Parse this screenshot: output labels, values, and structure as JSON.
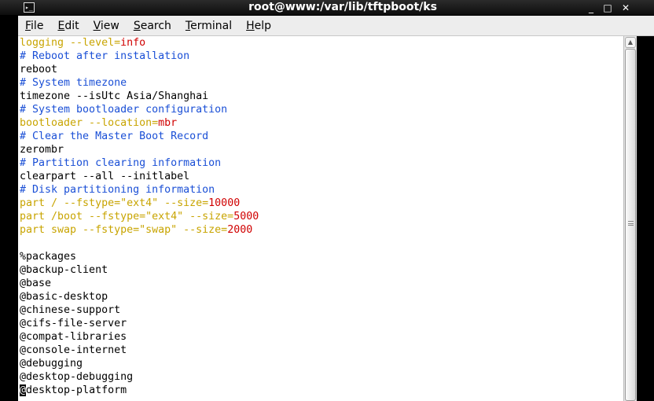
{
  "window": {
    "title": "root@www:/var/lib/tftpboot/ks",
    "minimize_glyph": "_",
    "maximize_glyph": "□",
    "close_glyph": "✕",
    "icon_glyph": "▸_"
  },
  "menu": [
    "File",
    "Edit",
    "View",
    "Search",
    "Terminal",
    "Help"
  ],
  "lines": [
    {
      "segs": [
        {
          "t": "logging --level=",
          "c": "key"
        },
        {
          "t": "info",
          "c": "val"
        }
      ]
    },
    {
      "segs": [
        {
          "t": "# Reboot after installation",
          "c": "comment"
        }
      ]
    },
    {
      "segs": [
        {
          "t": "reboot",
          "c": "plain"
        }
      ]
    },
    {
      "segs": [
        {
          "t": "# System timezone",
          "c": "comment"
        }
      ]
    },
    {
      "segs": [
        {
          "t": "timezone --isUtc Asia/Shanghai",
          "c": "plain"
        }
      ]
    },
    {
      "segs": [
        {
          "t": "# System bootloader configuration",
          "c": "comment"
        }
      ]
    },
    {
      "segs": [
        {
          "t": "bootloader --location=",
          "c": "key"
        },
        {
          "t": "mbr",
          "c": "val"
        }
      ]
    },
    {
      "segs": [
        {
          "t": "# Clear the Master Boot Record",
          "c": "comment"
        }
      ]
    },
    {
      "segs": [
        {
          "t": "zerombr",
          "c": "plain"
        }
      ]
    },
    {
      "segs": [
        {
          "t": "# Partition clearing information",
          "c": "comment"
        }
      ]
    },
    {
      "segs": [
        {
          "t": "clearpart --all --initlabel",
          "c": "plain"
        }
      ]
    },
    {
      "segs": [
        {
          "t": "# Disk partitioning information",
          "c": "comment"
        }
      ]
    },
    {
      "segs": [
        {
          "t": "part / --fstype=\"ext4\" --size=",
          "c": "key"
        },
        {
          "t": "10000",
          "c": "val"
        }
      ]
    },
    {
      "segs": [
        {
          "t": "part /boot --fstype=\"ext4\" --size=",
          "c": "key"
        },
        {
          "t": "5000",
          "c": "val"
        }
      ]
    },
    {
      "segs": [
        {
          "t": "part swap --fstype=\"swap\" --size=",
          "c": "key"
        },
        {
          "t": "2000",
          "c": "val"
        }
      ]
    },
    {
      "segs": [
        {
          "t": "",
          "c": "plain"
        }
      ]
    },
    {
      "segs": [
        {
          "t": "%packages",
          "c": "plain"
        }
      ]
    },
    {
      "segs": [
        {
          "t": "@backup-client",
          "c": "plain"
        }
      ]
    },
    {
      "segs": [
        {
          "t": "@base",
          "c": "plain"
        }
      ]
    },
    {
      "segs": [
        {
          "t": "@basic-desktop",
          "c": "plain"
        }
      ]
    },
    {
      "segs": [
        {
          "t": "@chinese-support",
          "c": "plain"
        }
      ]
    },
    {
      "segs": [
        {
          "t": "@cifs-file-server",
          "c": "plain"
        }
      ]
    },
    {
      "segs": [
        {
          "t": "@compat-libraries",
          "c": "plain"
        }
      ]
    },
    {
      "segs": [
        {
          "t": "@console-internet",
          "c": "plain"
        }
      ]
    },
    {
      "segs": [
        {
          "t": "@debugging",
          "c": "plain"
        }
      ]
    },
    {
      "segs": [
        {
          "t": "@desktop-debugging",
          "c": "plain"
        }
      ]
    },
    {
      "segs": [
        {
          "t": "@",
          "c": "cursor"
        },
        {
          "t": "desktop-platform",
          "c": "plain"
        }
      ]
    }
  ],
  "colors": {
    "comment": "#1a4fd6",
    "key": "#c8a400",
    "value": "#d00000",
    "background": "#ffffff"
  }
}
